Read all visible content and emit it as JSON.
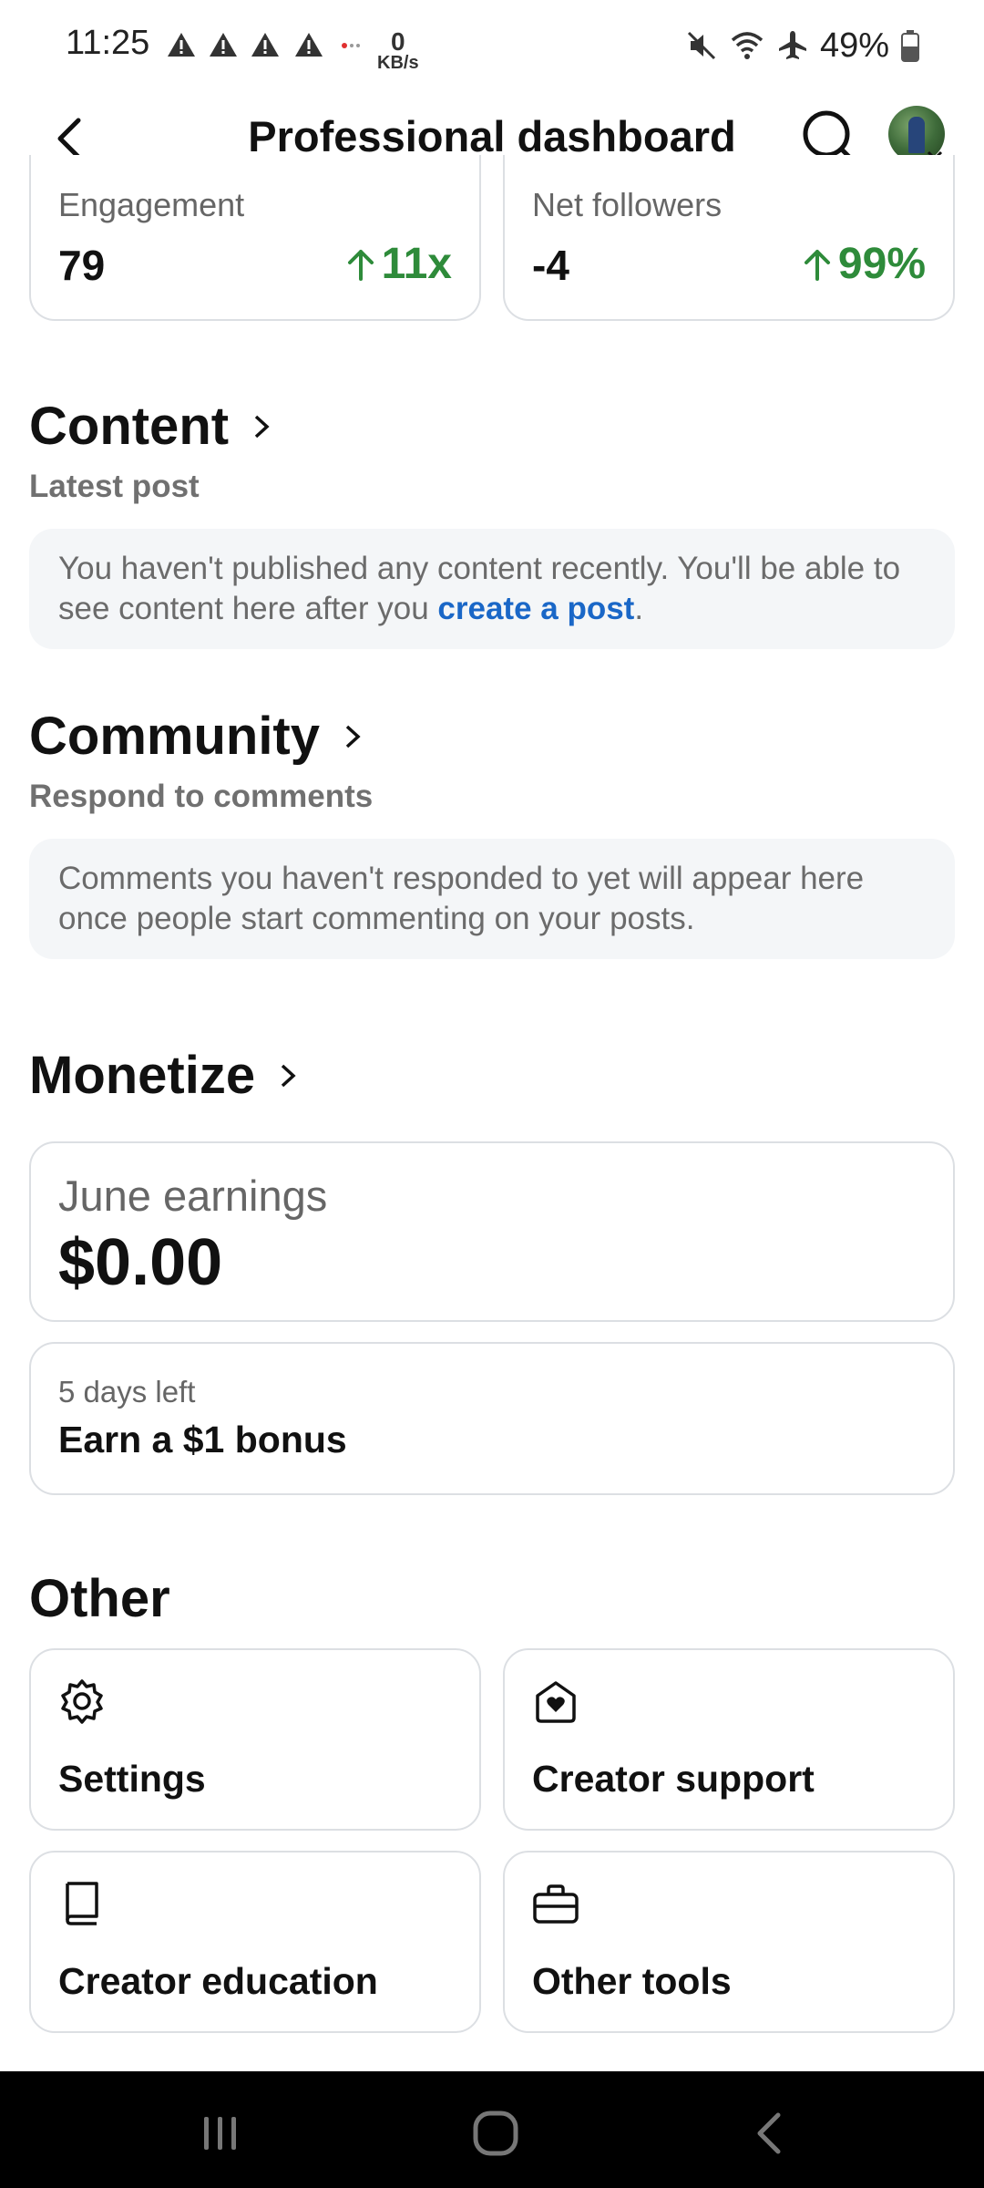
{
  "status_bar": {
    "time": "11:25",
    "net_speed_value": "0",
    "net_speed_unit": "KB/s",
    "battery": "49%",
    "icons": [
      "warning-icon",
      "warning-icon",
      "warning-icon",
      "warning-icon",
      "mute-icon",
      "wifi-icon",
      "airplane-icon",
      "battery-icon"
    ]
  },
  "header": {
    "title": "Professional dashboard",
    "back_icon": "chevron-left-icon",
    "search_icon": "search-icon"
  },
  "stats": [
    {
      "label": "Engagement",
      "value": "79",
      "change": "11x",
      "trend": "up"
    },
    {
      "label": "Net followers",
      "value": "-4",
      "change": "99%",
      "trend": "up"
    }
  ],
  "content": {
    "title": "Content",
    "subtitle": "Latest post",
    "message_before_link": "You haven't published any content recently. You'll be able to see content here after you ",
    "link_text": "create a post",
    "message_after_link": "."
  },
  "community": {
    "title": "Community",
    "subtitle": "Respond to comments",
    "message": "Comments you haven't responded to yet will appear here once people start commenting on your posts."
  },
  "monetize": {
    "title": "Monetize",
    "earnings_label": "June earnings",
    "earnings_value": "$0.00",
    "bonus_days": "5 days left",
    "bonus_title": "Earn a $1 bonus"
  },
  "other": {
    "title": "Other",
    "tiles": [
      {
        "label": "Settings",
        "icon": "gear-icon"
      },
      {
        "label": "Creator support",
        "icon": "support-heart-icon"
      },
      {
        "label": "Creator education",
        "icon": "book-icon"
      },
      {
        "label": "Other tools",
        "icon": "briefcase-icon"
      }
    ]
  },
  "colors": {
    "positive": "#2e8b3a",
    "link": "#1a67c7",
    "muted_text": "#6b6b6b",
    "card_border": "#dcdfe3",
    "info_bg": "#f4f6f8"
  }
}
